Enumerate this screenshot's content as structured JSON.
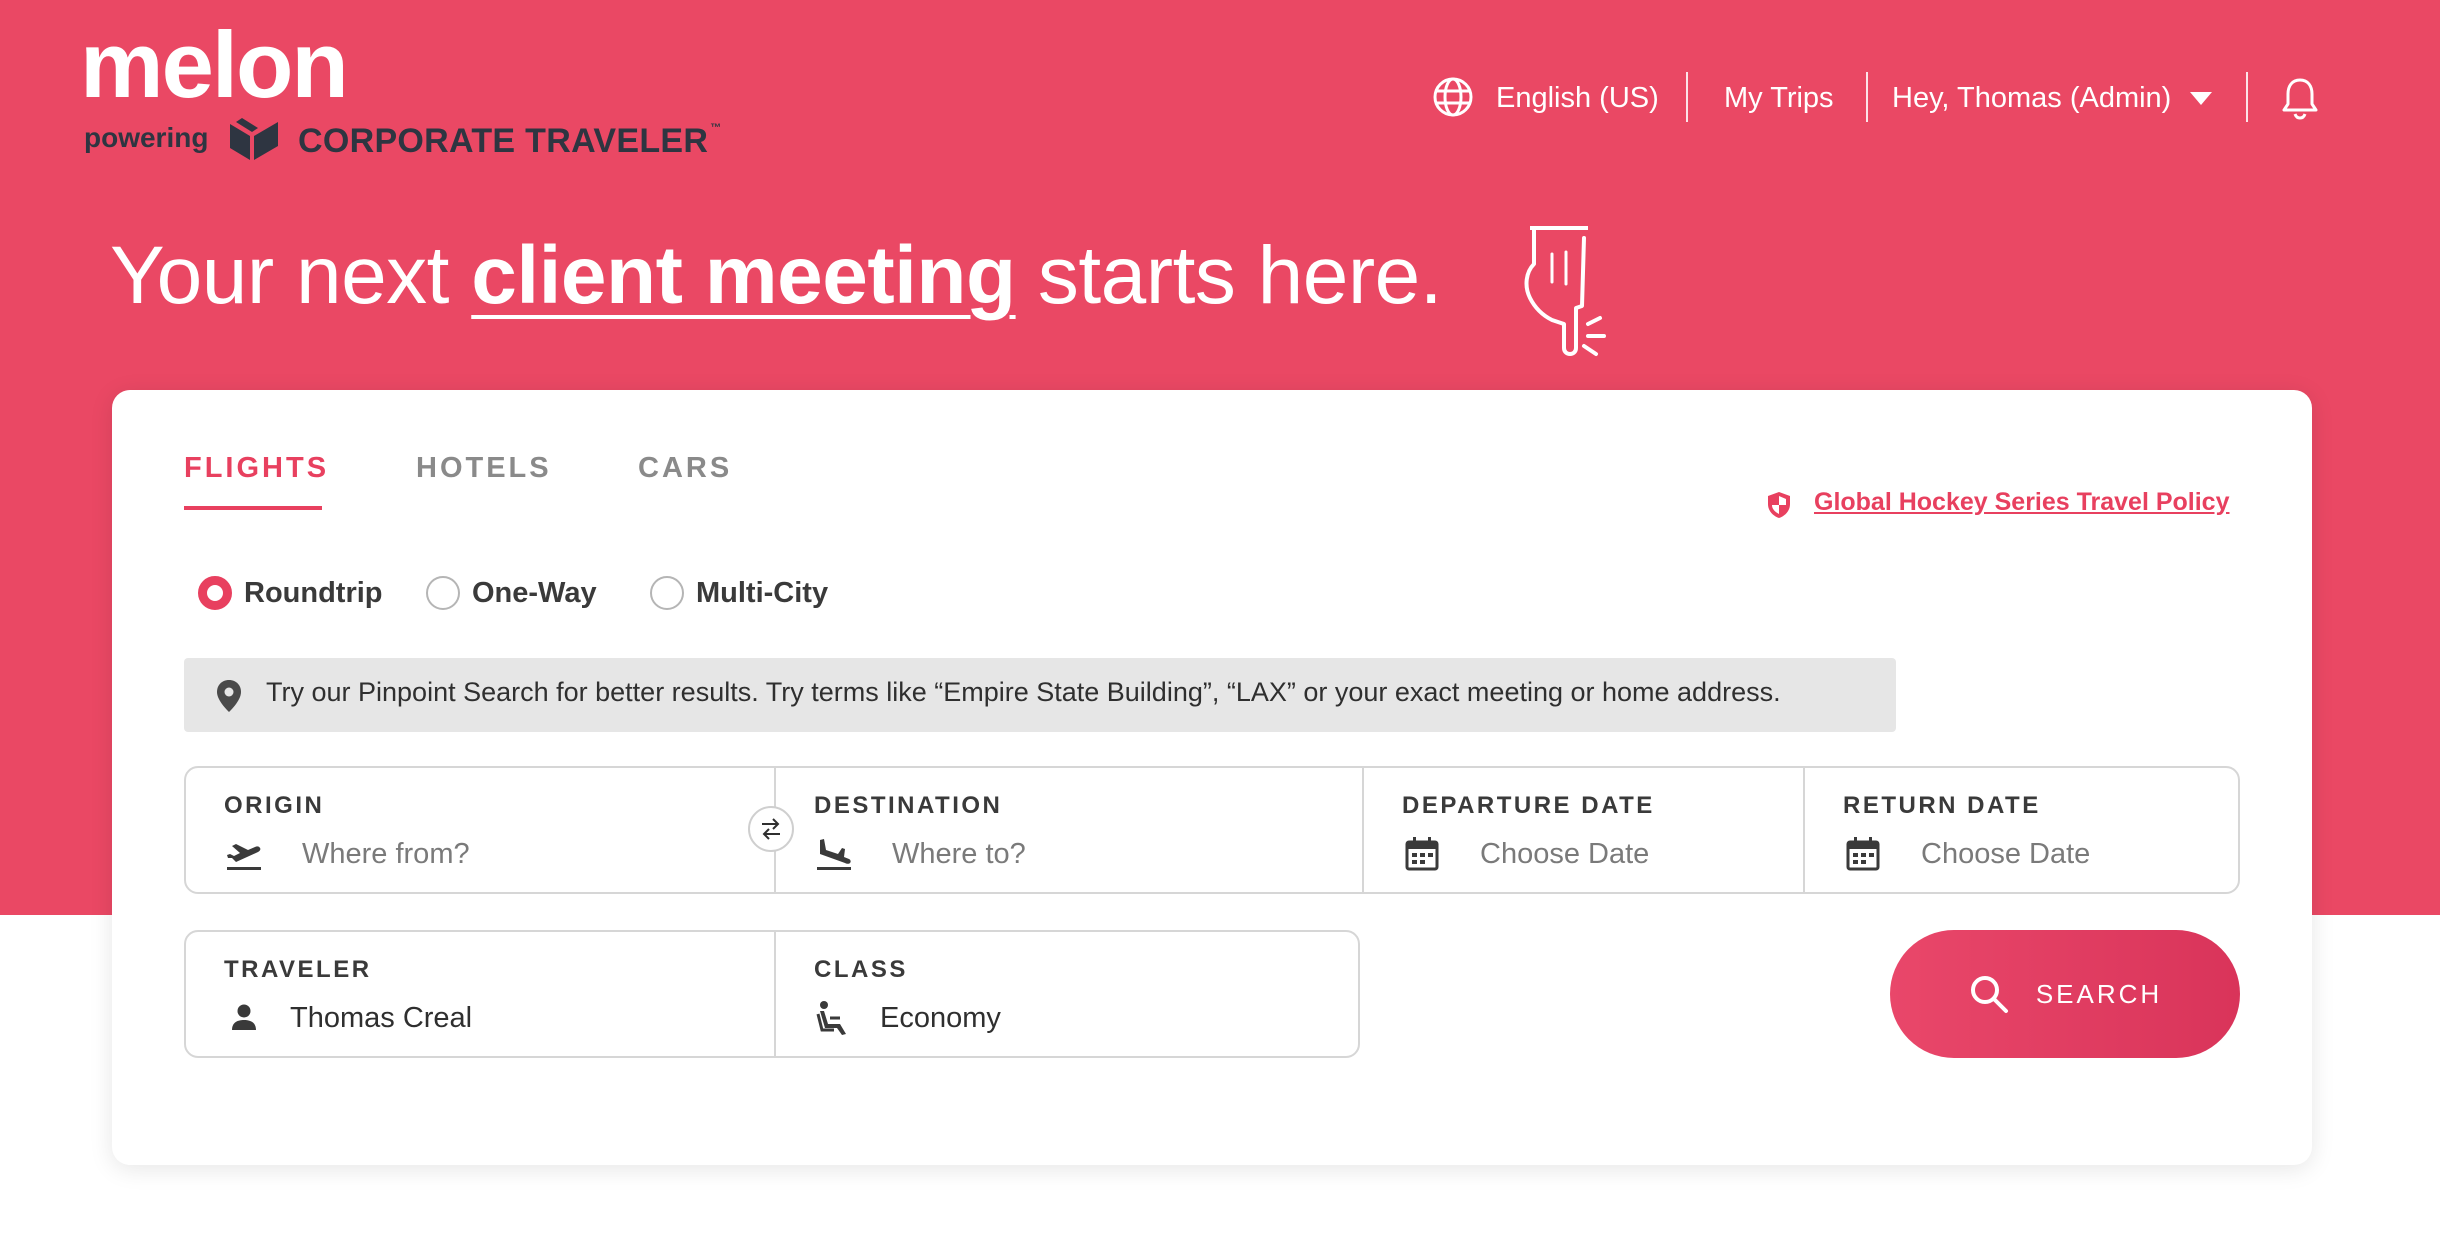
{
  "brand": {
    "logo": "melon",
    "powering": "powering",
    "partner": "CORPORATE TRAVELER",
    "partner_tm": "™"
  },
  "nav": {
    "language": "English (US)",
    "my_trips": "My Trips",
    "user": "Hey, Thomas (Admin)"
  },
  "hero": {
    "before": "Your next ",
    "highlight": "client meeting",
    "after": " starts here."
  },
  "tabs": [
    {
      "label": "FLIGHTS",
      "active": true
    },
    {
      "label": "HOTELS",
      "active": false
    },
    {
      "label": "CARS",
      "active": false
    }
  ],
  "policy_link": "Global Hockey Series Travel Policy",
  "trip_types": [
    {
      "label": "Roundtrip",
      "selected": true
    },
    {
      "label": "One-Way",
      "selected": false
    },
    {
      "label": "Multi-City",
      "selected": false
    }
  ],
  "tip": "Try our Pinpoint Search for better results. Try terms like “Empire State Building”, “LAX” or your exact meeting or home address.",
  "fields": {
    "origin": {
      "label": "ORIGIN",
      "placeholder": "Where from?"
    },
    "destination": {
      "label": "DESTINATION",
      "placeholder": "Where to?"
    },
    "departure": {
      "label": "DEPARTURE DATE",
      "placeholder": "Choose Date"
    },
    "return": {
      "label": "RETURN DATE",
      "placeholder": "Choose Date"
    },
    "traveler": {
      "label": "TRAVELER",
      "value": "Thomas Creal"
    },
    "class": {
      "label": "CLASS",
      "value": "Economy"
    }
  },
  "search_button": "SEARCH",
  "colors": {
    "brand": "#ea4864",
    "accent": "#e8405f",
    "dark": "#2e3541"
  }
}
